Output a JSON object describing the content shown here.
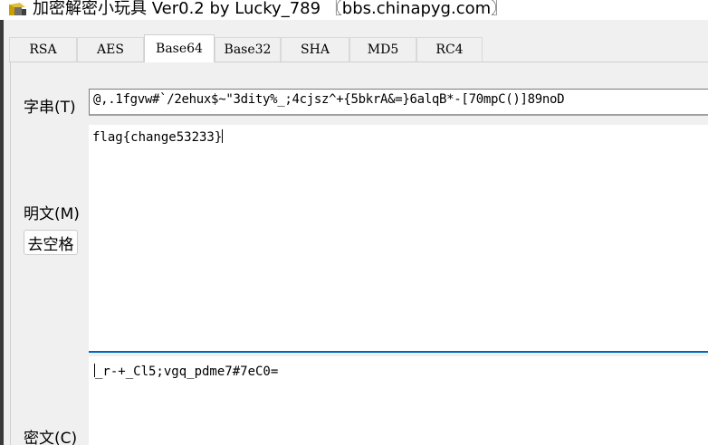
{
  "window": {
    "title": "加密解密小玩具 Ver0.2 by Lucky_789 〖bbs.chinapyg.com〗"
  },
  "tabs": [
    {
      "label": "RSA",
      "active": false
    },
    {
      "label": "AES",
      "active": false
    },
    {
      "label": "Base64",
      "active": true
    },
    {
      "label": "Base32",
      "active": false
    },
    {
      "label": "SHA",
      "active": false
    },
    {
      "label": "MD5",
      "active": false
    },
    {
      "label": "RC4",
      "active": false
    }
  ],
  "form": {
    "key_label": "字串(T)",
    "key_value": "@,.1fgvw#`/2ehux$~\"3dity%_;4cjsz^+{5bkrA&=}6alqB*-[70mpC()]89noD",
    "plaintext_label": "明文(M)",
    "plaintext_value": "flag{change53233}",
    "remove_spaces_button": "去空格",
    "ciphertext_label": "密文(C)",
    "ciphertext_value": "_r-+_Cl5;vgq_pdme7#7eC0="
  },
  "colors": {
    "focus_underline": "#0067c0",
    "panel_bg": "#f0f0f0"
  }
}
